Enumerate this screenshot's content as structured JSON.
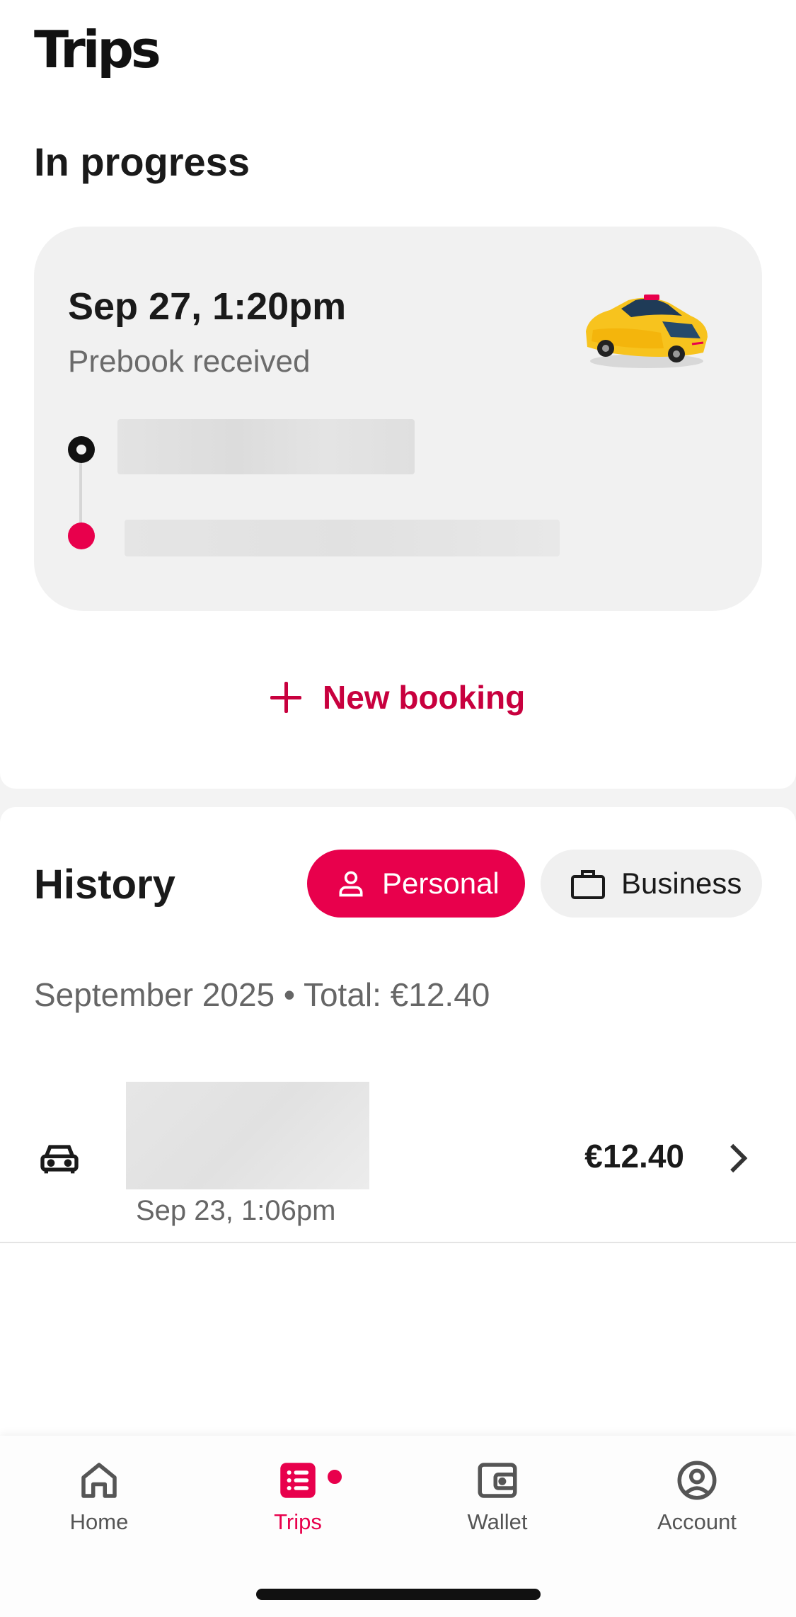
{
  "header": {
    "title": "Trips"
  },
  "in_progress": {
    "section_title": "In progress",
    "trip": {
      "datetime": "Sep 27, 1:20pm",
      "status": "Prebook received"
    },
    "new_booking_label": "New booking"
  },
  "history": {
    "title": "History",
    "filters": [
      {
        "label": "Personal",
        "selected": true
      },
      {
        "label": "Business",
        "selected": false
      }
    ],
    "summary": "September 2025 • Total: €12.40",
    "trips": [
      {
        "datetime": "Sep 23, 1:06pm",
        "price": "€12.40"
      }
    ]
  },
  "nav": {
    "items": [
      {
        "label": "Home",
        "icon": "home-icon"
      },
      {
        "label": "Trips",
        "icon": "trips-icon",
        "active": true,
        "has_badge": true
      },
      {
        "label": "Wallet",
        "icon": "wallet-icon"
      },
      {
        "label": "Account",
        "icon": "account-icon"
      }
    ]
  },
  "colors": {
    "accent": "#e8004c",
    "accent_text": "#c8003e"
  }
}
